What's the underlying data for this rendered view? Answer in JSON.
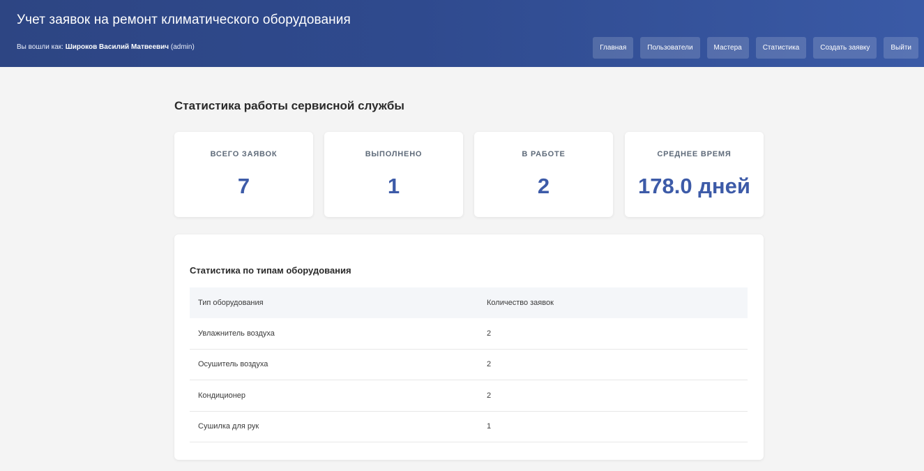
{
  "header": {
    "title": "Учет заявок на ремонт климатического оборудования",
    "user_prefix": "Вы вошли как:",
    "user_name": "Широков Василий Матвеевич",
    "user_role": "(admin)",
    "nav": [
      {
        "label": "Главная"
      },
      {
        "label": "Пользователи"
      },
      {
        "label": "Мастера"
      },
      {
        "label": "Статистика"
      },
      {
        "label": "Создать заявку"
      },
      {
        "label": "Выйти"
      }
    ]
  },
  "main": {
    "title": "Статистика работы сервисной службы",
    "stats": [
      {
        "label": "ВСЕГО ЗАЯВОК",
        "value": "7"
      },
      {
        "label": "ВЫПОЛНЕНО",
        "value": "1"
      },
      {
        "label": "В РАБОТЕ",
        "value": "2"
      },
      {
        "label": "СРЕДНЕЕ ВРЕМЯ",
        "value": "178.0 дней"
      }
    ],
    "equipment": {
      "title": "Статистика по типам оборудования",
      "columns": [
        "Тип оборудования",
        "Количество заявок"
      ],
      "rows": [
        [
          "Увлажнитель воздуха",
          "2"
        ],
        [
          "Осушитель воздуха",
          "2"
        ],
        [
          "Кондиционер",
          "2"
        ],
        [
          "Сушилка для рук",
          "1"
        ]
      ]
    }
  },
  "colors": {
    "header_start": "#2d4583",
    "header_end": "#3a5aa6",
    "stat_value": "#3d5ba8",
    "background": "#f4f4f4"
  }
}
